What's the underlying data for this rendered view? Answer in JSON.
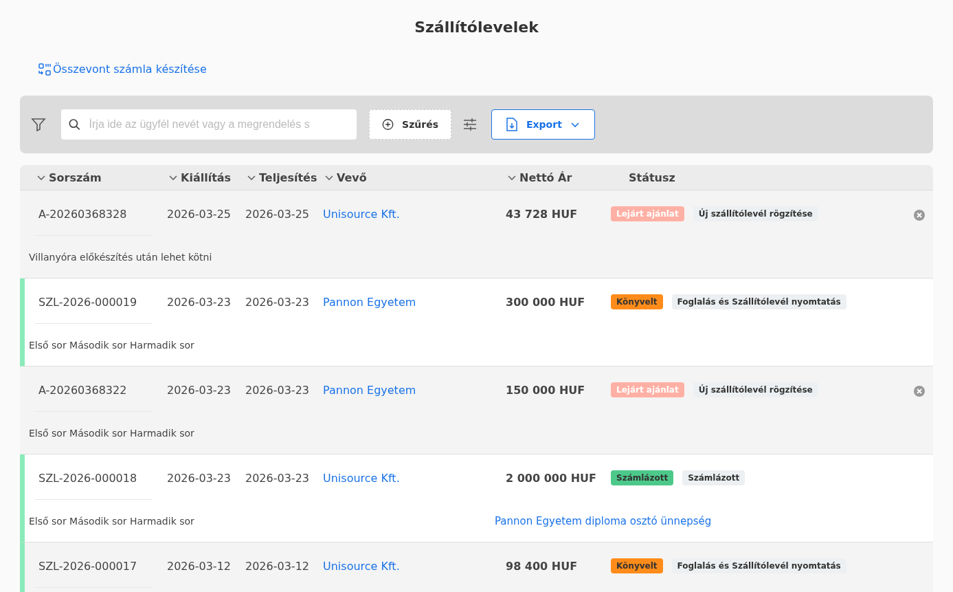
{
  "title": "Szállítólevelek",
  "merge_link": "Összevont számla készítése",
  "toolbar": {
    "search": {
      "placeholder": "Írja ide az ügyfél nevét vagy a megrendelés s"
    },
    "filter_button": "Szűrés",
    "export_button": "Export"
  },
  "table": {
    "columns": [
      {
        "label": "Sorszám",
        "sortable": true
      },
      {
        "label": "Kiállítás",
        "sortable": true
      },
      {
        "label": "Teljesítés",
        "sortable": true
      },
      {
        "label": "Vevő",
        "sortable": true
      },
      {
        "label": "Nettó Ár",
        "sortable": true
      },
      {
        "label": "Státusz",
        "sortable": false
      }
    ],
    "rows": [
      {
        "number": "A-20260368328",
        "issued": "2026-03-25",
        "completed": "2026-03-25",
        "customer": "Unisource Kft.",
        "net": "43 728 HUF",
        "marked": false,
        "removable": true,
        "statuses": [
          {
            "label": "Lejárt ajánlat",
            "color": "#ffb0a4",
            "kind": "faded"
          },
          {
            "label": "Új szállítólevél rögzítése",
            "color": "#edf0f2",
            "kind": "solid"
          }
        ],
        "note": "Villanyóra előkészítés után lehet kötni"
      },
      {
        "number": "SZL-2026-000019",
        "issued": "2026-03-23",
        "completed": "2026-03-23",
        "customer": "Pannon Egyetem",
        "net": "300 000 HUF",
        "marked": true,
        "removable": false,
        "statuses": [
          {
            "label": "Könyvelt",
            "color": "#ff8c1a",
            "kind": "solid"
          },
          {
            "label": "Foglalás és Szállítólevél nyomtatás",
            "color": "#edf0f2",
            "kind": "solid"
          }
        ],
        "note": "Első sor Második sor Harmadik sor"
      },
      {
        "number": "A-20260368322",
        "issued": "2026-03-23",
        "completed": "2026-03-23",
        "customer": "Pannon Egyetem",
        "net": "150 000 HUF",
        "marked": false,
        "removable": true,
        "statuses": [
          {
            "label": "Lejárt ajánlat",
            "color": "#ffb0a4",
            "kind": "faded"
          },
          {
            "label": "Új szállítólevél rögzítése",
            "color": "#edf0f2",
            "kind": "solid"
          }
        ],
        "note": "Első sor Második sor Harmadik sor"
      },
      {
        "number": "SZL-2026-000018",
        "issued": "2026-03-23",
        "completed": "2026-03-23",
        "customer": "Unisource Kft.",
        "net": "2 000 000 HUF",
        "marked": true,
        "removable": false,
        "statuses": [
          {
            "label": "Számlázott",
            "color": "#4cc98a",
            "kind": "solid"
          },
          {
            "label": "Számlázott",
            "color": "#edf0f2",
            "kind": "solid"
          }
        ],
        "note": "Első sor Második sor Harmadik sor",
        "event_link": "Pannon Egyetem diploma osztó ünnepség"
      },
      {
        "number": "SZL-2026-000017",
        "issued": "2026-03-12",
        "completed": "2026-03-12",
        "customer": "Unisource Kft.",
        "net": "98 400 HUF",
        "marked": true,
        "removable": false,
        "statuses": [
          {
            "label": "Könyvelt",
            "color": "#ff8c1a",
            "kind": "solid"
          },
          {
            "label": "Foglalás és Szállítólevél nyomtatás",
            "color": "#edf0f2",
            "kind": "solid"
          }
        ]
      }
    ]
  }
}
